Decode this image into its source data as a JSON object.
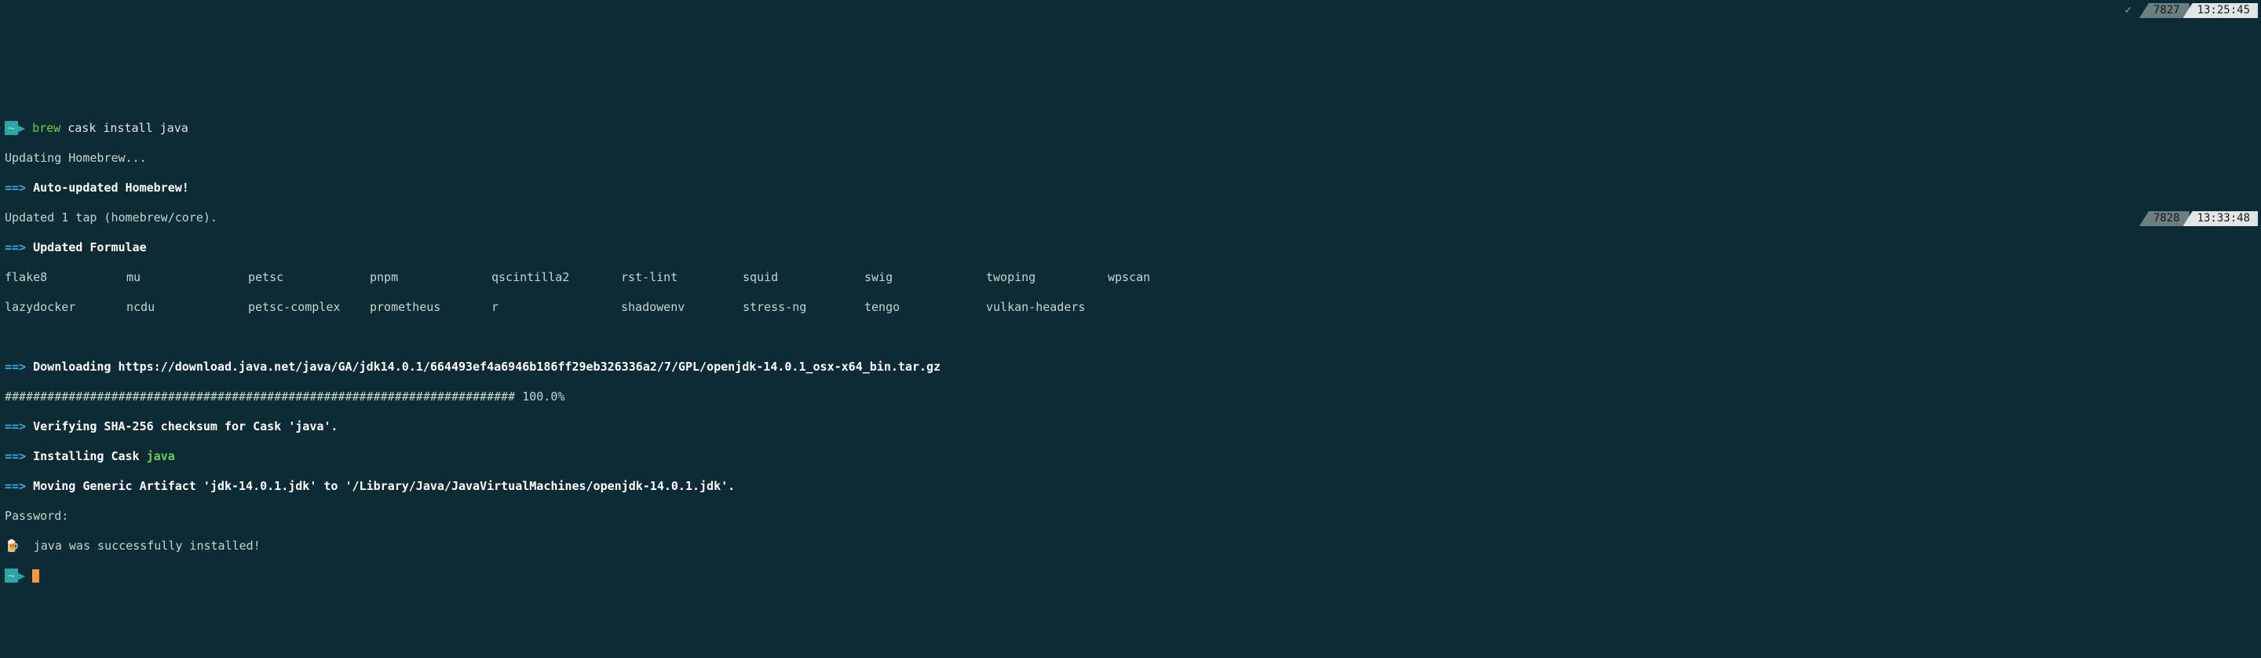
{
  "prompt": {
    "tilde": "~",
    "sep": "▶",
    "command_green": "brew",
    "command_rest": "cask install java"
  },
  "lines": {
    "updating": "Updating Homebrew...",
    "arrow": "==>",
    "auto_updated": "Auto-updated Homebrew!",
    "updated_tap": "Updated 1 tap (homebrew/core).",
    "updated_formulae": "Updated Formulae",
    "downloading": "Downloading https://download.java.net/java/GA/jdk14.0.1/664493ef4a6946b186ff29eb326336a2/7/GPL/openjdk-14.0.1_osx-x64_bin.tar.gz",
    "progress": "######################################################################## 100.0%",
    "verifying": "Verifying SHA-256 checksum for Cask 'java'.",
    "installing_cask_prefix": "Installing Cask ",
    "installing_cask_name": "java",
    "moving": "Moving Generic Artifact 'jdk-14.0.1.jdk' to '/Library/Java/JavaVirtualMachines/openjdk-14.0.1.jdk'.",
    "password": "Password:",
    "success": "  java was successfully installed!",
    "beer": "🍺"
  },
  "formulae": {
    "row1": [
      "flake8",
      "mu",
      "petsc",
      "pnpm",
      "qscintilla2",
      "rst-lint",
      "squid",
      "swig",
      "twoping",
      "wpscan"
    ],
    "row2": [
      "lazydocker",
      "ncdu",
      "petsc-complex",
      "prometheus",
      "r",
      "shadowenv",
      "stress-ng",
      "tengo",
      "vulkan-headers",
      ""
    ]
  },
  "status_top": {
    "check": "✓",
    "num": "7827",
    "time": "13:25:45"
  },
  "status_bottom": {
    "num": "7828",
    "time": "13:33:48"
  }
}
